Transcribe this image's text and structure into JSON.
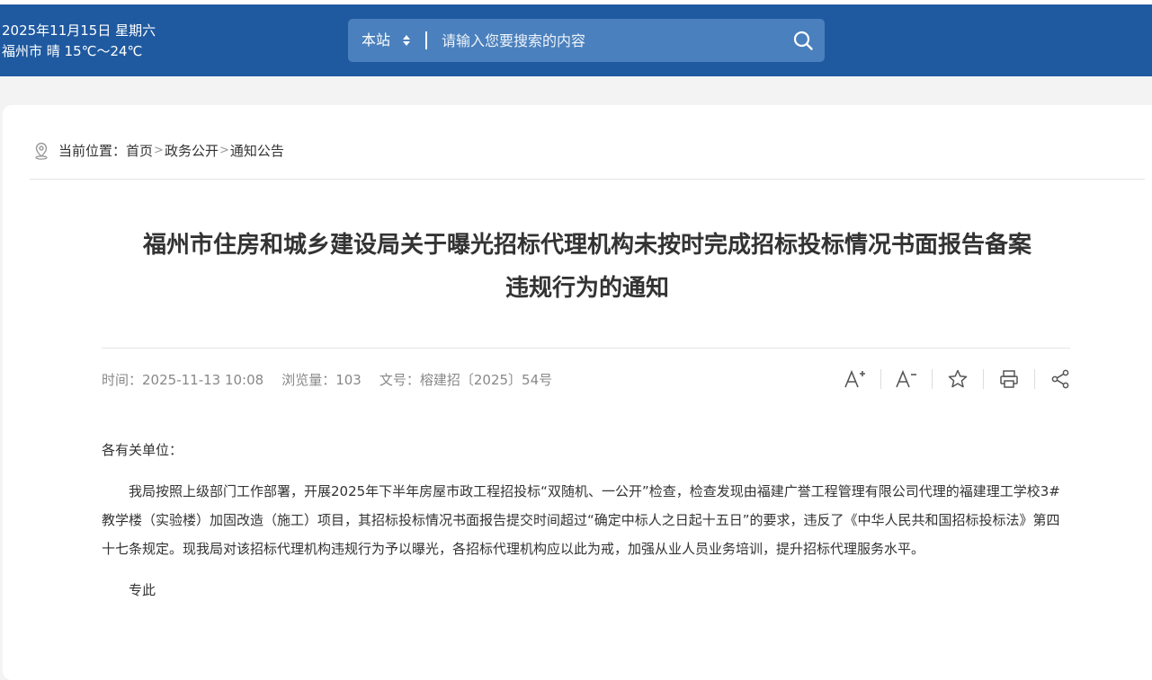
{
  "header": {
    "date_line": "2025年11月15日 星期六",
    "weather_line": "福州市 晴 15℃～24℃",
    "search": {
      "scope_label": "本站",
      "placeholder": "请输入您要搜索的内容",
      "search_icon": "search-icon"
    }
  },
  "breadcrumb": {
    "prefix": "当前位置：",
    "items": [
      "首页",
      "政务公开",
      "通知公告"
    ],
    "separator": ">"
  },
  "article": {
    "title_line1": "福州市住房和城乡建设局关于曝光招标代理机构未按时完成招标投标情况书面报告备案",
    "title_line2": "违规行为的通知",
    "meta": {
      "time_label": "时间：",
      "time_value": "2025-11-13 10:08",
      "views_label": "浏览量：",
      "views_value": "103",
      "docno_label": "文号：",
      "docno_value": "榕建招〔2025〕54号"
    },
    "tools": [
      "font-increase-icon",
      "font-decrease-icon",
      "star-icon",
      "print-icon",
      "share-icon"
    ],
    "salutation": "各有关单位：",
    "paragraph": "我局按照上级部门工作部署，开展2025年下半年房屋市政工程招投标“双随机、一公开”检查，检查发现由福建广誉工程管理有限公司代理的福建理工学校3#教学楼（实验楼）加固改造（施工）项目，其招标投标情况书面报告提交时间超过“确定中标人之日起十五日”的要求，违反了《中华人民共和国招标投标法》第四十七条规定。现我局对该招标代理机构违规行为予以曝光，各招标代理机构应以此为戒，加强从业人员业务培训，提升招标代理服务水平。",
    "closing": "专此"
  },
  "colors": {
    "header_bg": "#1f5aa0",
    "search_bg": "#4a80bd"
  }
}
